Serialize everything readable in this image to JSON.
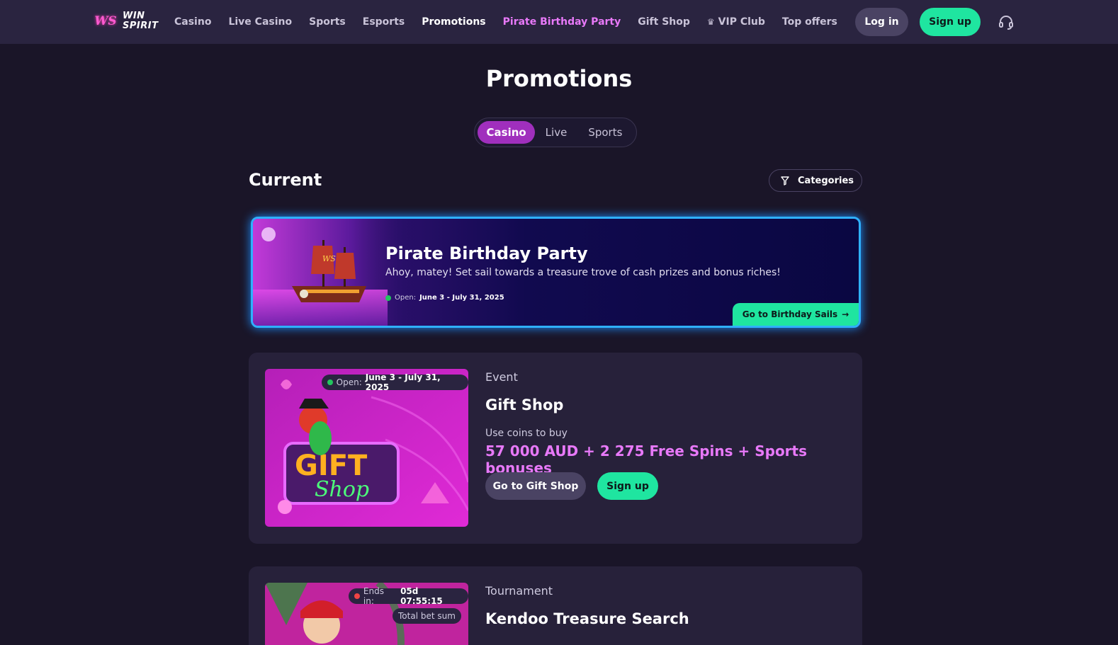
{
  "header": {
    "logo_text_line1": "WIN",
    "logo_text_line2": "SPIRIT",
    "logo_mark": "WS",
    "nav": [
      {
        "label": "Casino"
      },
      {
        "label": "Live Casino"
      },
      {
        "label": "Sports"
      },
      {
        "label": "Esports"
      },
      {
        "label": "Promotions"
      },
      {
        "label": "Pirate Birthday Party"
      },
      {
        "label": "Gift Shop"
      },
      {
        "label": "VIP Club",
        "icon": "crown-icon"
      },
      {
        "label": "Top offers"
      }
    ],
    "more_icon": "more-icon",
    "login_label": "Log in",
    "signup_label": "Sign up",
    "support_icon": "headset-icon"
  },
  "page": {
    "title": "Promotions",
    "tabs": [
      {
        "label": "Casino",
        "active": true
      },
      {
        "label": "Live",
        "active": false
      },
      {
        "label": "Sports",
        "active": false
      }
    ],
    "section_title": "Current",
    "categories_label": "Categories",
    "categories_icon": "filter-icon"
  },
  "banner": {
    "title": "Pirate Birthday Party",
    "description": "Ahoy, matey! Set sail towards a treasure trove of cash prizes and bonus riches!",
    "date_prefix": "Open:",
    "date_value": "June 3 - July 31, 2025",
    "cta_label": "Go to Birthday Sails",
    "cta_icon": "arrow-right-icon"
  },
  "cards": [
    {
      "chip_prefix": "Open:",
      "chip_value": "June 3 - July 31, 2025",
      "kind": "Event",
      "title": "Gift Shop",
      "subtitle": "Use coins to buy",
      "highlight": "57 000 AUD + 2 275 Free Spins + Sports bonuses",
      "primary_label": "Go to Gift Shop",
      "secondary_label": "Sign up"
    },
    {
      "chip_prefix": "Ends in:",
      "chip_value": "05d 07:55:15",
      "chip2": "Total bet sum",
      "kind": "Tournament",
      "title": "Kendoo Treasure Search"
    }
  ],
  "colors": {
    "background": "#1a1528",
    "header": "#2a2440",
    "accent_green": "#1fe5a0",
    "accent_pink": "#e879f9",
    "tab_active": "#a02fbd",
    "banner_border": "#2fb0ff"
  }
}
